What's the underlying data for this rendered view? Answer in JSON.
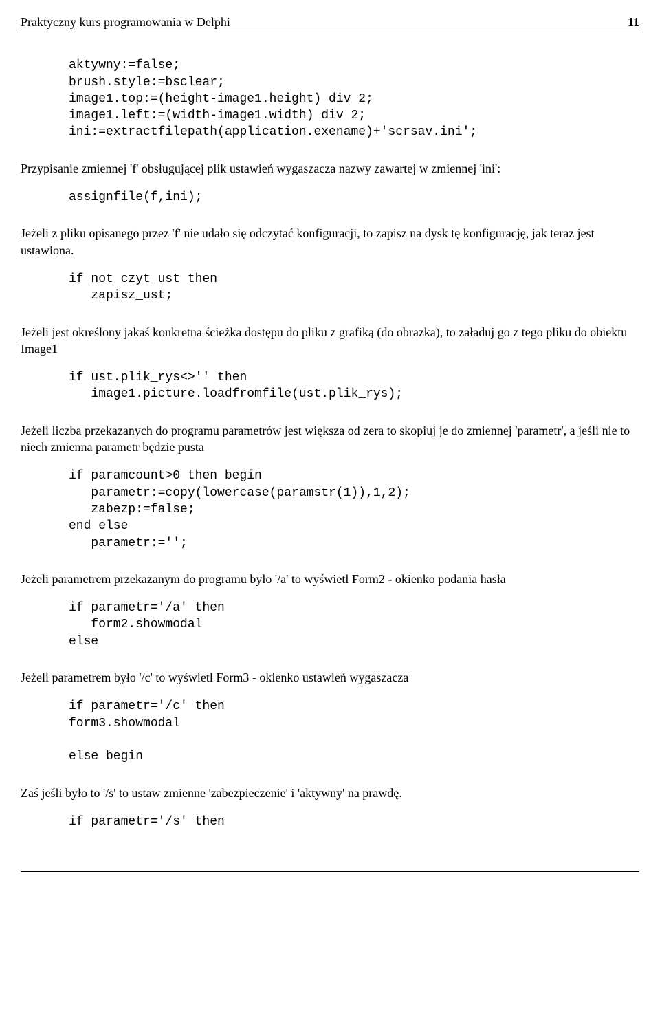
{
  "header": {
    "title": "Praktyczny kurs programowania w Delphi",
    "page_number": "11"
  },
  "code1": "aktywny:=false;\nbrush.style:=bsclear;\nimage1.top:=(height-image1.height) div 2;\nimage1.left:=(width-image1.width) div 2;\nini:=extractfilepath(application.exename)+'scrsav.ini';",
  "para1": "Przypisanie zmiennej 'f' obsługującej plik ustawień wygaszacza nazwy zawartej w zmiennej 'ini':",
  "code2": "assignfile(f,ini);",
  "para2": "Jeżeli z pliku opisanego przez 'f' nie udało się odczytać konfiguracji, to zapisz na dysk tę konfigurację, jak teraz jest ustawiona.",
  "code3": "if not czyt_ust then\n   zapisz_ust;",
  "para3": "Jeżeli jest określony jakaś konkretna ścieżka dostępu do pliku z grafiką (do obrazka), to załaduj go z tego pliku do obiektu Image1",
  "code4": "if ust.plik_rys<>'' then\n   image1.picture.loadfromfile(ust.plik_rys);",
  "para4": "Jeżeli liczba przekazanych do programu parametrów jest większa od zera to skopiuj je do zmiennej 'parametr', a jeśli nie to niech zmienna parametr będzie pusta",
  "code5": "if paramcount>0 then begin\n   parametr:=copy(lowercase(paramstr(1)),1,2);\n   zabezp:=false;\nend else\n   parametr:='';",
  "para5": "Jeżeli parametrem przekazanym do programu było '/a' to wyświetl Form2 - okienko podania hasła",
  "code6": "if parametr='/a' then\n   form2.showmodal\nelse",
  "para6": "Jeżeli parametrem było '/c' to wyświetl Form3 - okienko ustawień wygaszacza",
  "code7": "if parametr='/c' then\nform3.showmodal\n\nelse begin",
  "para7": "Zaś jeśli było to '/s' to ustaw zmienne 'zabezpieczenie' i 'aktywny' na prawdę.",
  "code8": "if parametr='/s' then"
}
